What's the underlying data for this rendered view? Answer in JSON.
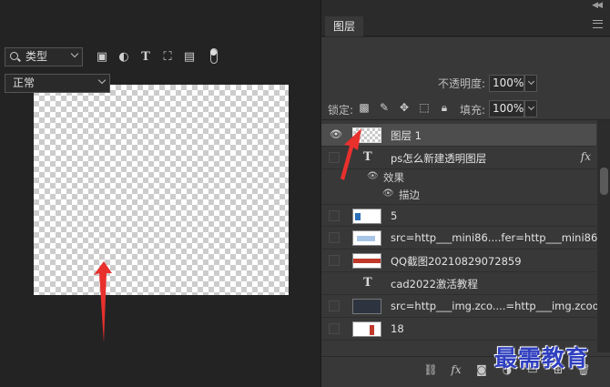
{
  "panel": {
    "tab_label": "图层",
    "filter": {
      "kind_label": "类型"
    },
    "blend_mode": "正常",
    "opacity_label": "不透明度:",
    "opacity_value": "100%",
    "lock_label": "锁定:",
    "fill_label": "填充:",
    "fill_value": "100%"
  },
  "layers": [
    {
      "name": "图层 1",
      "type": "pixel",
      "thumb": "checker",
      "visible": true,
      "selected": true
    },
    {
      "name": "ps怎么新建透明图层",
      "type": "text",
      "fx": "fx",
      "effects_label": "效果",
      "effect_stroke": "描边"
    },
    {
      "name": "5",
      "type": "pixel",
      "thumb": "image"
    },
    {
      "name": "src=http___mini86....fer=http___mini86",
      "type": "pixel",
      "thumb": "image"
    },
    {
      "name": "QQ截图20210829072859",
      "type": "pixel",
      "thumb": "image-red"
    },
    {
      "name": "cad2022激活教程",
      "type": "text"
    },
    {
      "name": "src=http___img.zco....=http___img.zcool",
      "type": "pixel",
      "thumb": "dark"
    },
    {
      "name": "18",
      "type": "pixel",
      "thumb": "image-red"
    }
  ],
  "watermark": "最需教育",
  "colors": {
    "canvas_bg": "#232323",
    "panel_bg": "#383838",
    "selected_row": "#4d4d4d",
    "annotation_arrow": "#e8302d"
  }
}
